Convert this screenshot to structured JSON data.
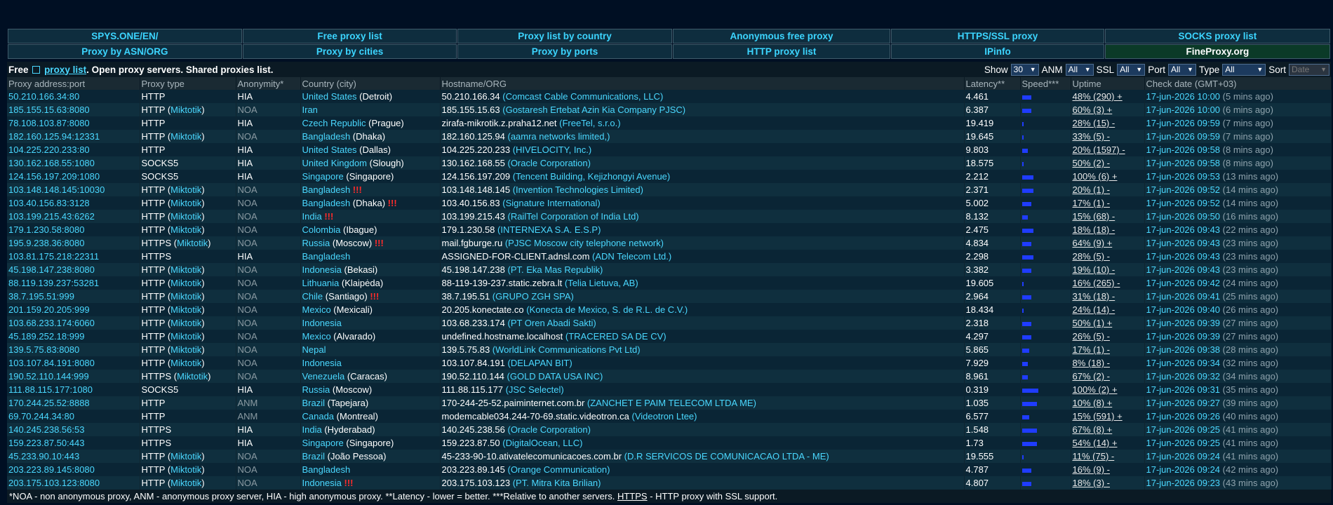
{
  "nav": {
    "row1": [
      "SPYS.ONE/EN/",
      "Free proxy list",
      "Proxy list by country",
      "Anonymous free proxy",
      "HTTPS/SSL proxy",
      "SOCKS proxy list"
    ],
    "row2": [
      "Proxy by ASN/ORG",
      "Proxy by cities",
      "Proxy by ports",
      "HTTP proxy list",
      "IPinfo",
      "FineProxy.org"
    ]
  },
  "header": {
    "free_label": "Free",
    "proxy_list_link": "proxy list",
    "rest": ". Open proxy servers. Shared proxies list."
  },
  "filters": {
    "show_label": "Show",
    "show_value": "30",
    "anm_label": "ANM",
    "anm_value": "All",
    "ssl_label": "SSL",
    "ssl_value": "All",
    "port_label": "Port",
    "port_value": "All",
    "type_label": "Type",
    "type_value": "All",
    "sort_label": "Sort",
    "sort_value": "Date"
  },
  "columns": [
    "Proxy address:port",
    "Proxy type",
    "Anonymity*",
    "Country (city)",
    "Hostname/ORG",
    "Latency**",
    "Speed***",
    "Uptime",
    "Check date (GMT+03)"
  ],
  "colors": {
    "accent": "#4ad8ff",
    "warn": "#ff2b2b",
    "speed": "#1f3cff",
    "bg": "#000f23"
  },
  "rows": [
    {
      "addr": "50.210.166.34:80",
      "type": "HTTP",
      "sub": "",
      "anon": "HIA",
      "country": "United States",
      "city": "Detroit",
      "warn": "",
      "host": "50.210.166.34",
      "org": "Comcast Cable Communications, LLC",
      "lat": "4.461",
      "spd": 0.25,
      "up": "48% (290) +",
      "date": "17-jun-2026 10:00",
      "ago": "(5 mins ago)"
    },
    {
      "addr": "185.155.15.63:8080",
      "type": "HTTP",
      "sub": "Miktotik",
      "anon": "NOA",
      "country": "Iran",
      "city": "",
      "warn": "",
      "host": "185.155.15.63",
      "org": "Gostaresh Ertebat Azin Kia Company PJSC",
      "lat": "6.387",
      "spd": 0.25,
      "up": "60% (3) +",
      "date": "17-jun-2026 10:00",
      "ago": "(6 mins ago)"
    },
    {
      "addr": "78.108.103.87:8080",
      "type": "HTTP",
      "sub": "",
      "anon": "HIA",
      "country": "Czech Republic",
      "city": "Prague",
      "warn": "",
      "host": "zirafa-mikrotik.z.praha12.net",
      "org": "FreeTel, s.r.o.",
      "lat": "19.419",
      "spd": 0.03,
      "up": "28% (15) -",
      "date": "17-jun-2026 09:59",
      "ago": "(7 mins ago)"
    },
    {
      "addr": "182.160.125.94:12331",
      "type": "HTTP",
      "sub": "Miktotik",
      "anon": "NOA",
      "country": "Bangladesh",
      "city": "Dhaka",
      "warn": "",
      "host": "182.160.125.94",
      "org": "aamra networks limited,",
      "lat": "19.645",
      "spd": 0.03,
      "up": "33% (5) -",
      "date": "17-jun-2026 09:59",
      "ago": "(7 mins ago)"
    },
    {
      "addr": "104.225.220.233:80",
      "type": "HTTP",
      "sub": "",
      "anon": "HIA",
      "country": "United States",
      "city": "Dallas",
      "warn": "",
      "host": "104.225.220.233",
      "org": "HIVELOCITY, Inc.",
      "lat": "9.803",
      "spd": 0.15,
      "up": "20% (1597) -",
      "date": "17-jun-2026 09:58",
      "ago": "(8 mins ago)"
    },
    {
      "addr": "130.162.168.55:1080",
      "type": "SOCKS5",
      "sub": "",
      "anon": "HIA",
      "country": "United Kingdom",
      "city": "Slough",
      "warn": "",
      "host": "130.162.168.55",
      "org": "Oracle Corporation",
      "lat": "18.575",
      "spd": 0.03,
      "up": "50% (2) -",
      "date": "17-jun-2026 09:58",
      "ago": "(8 mins ago)"
    },
    {
      "addr": "124.156.197.209:1080",
      "type": "SOCKS5",
      "sub": "",
      "anon": "HIA",
      "country": "Singapore",
      "city": "Singapore",
      "warn": "",
      "host": "124.156.197.209",
      "org": "Tencent Building, Kejizhongyi Avenue",
      "lat": "2.212",
      "spd": 0.3,
      "up": "100% (6) +",
      "date": "17-jun-2026 09:53",
      "ago": "(13 mins ago)"
    },
    {
      "addr": "103.148.148.145:10030",
      "type": "HTTP",
      "sub": "Miktotik",
      "anon": "NOA",
      "country": "Bangladesh",
      "city": "",
      "warn": "!!!",
      "host": "103.148.148.145",
      "org": "Invention Technologies Limited",
      "lat": "2.371",
      "spd": 0.3,
      "up": "20% (1) -",
      "date": "17-jun-2026 09:52",
      "ago": "(14 mins ago)"
    },
    {
      "addr": "103.40.156.83:3128",
      "type": "HTTP",
      "sub": "Miktotik",
      "anon": "NOA",
      "country": "Bangladesh",
      "city": "Dhaka",
      "warn": "!!!",
      "host": "103.40.156.83",
      "org": "Signature International",
      "lat": "5.002",
      "spd": 0.25,
      "up": "17% (1) -",
      "date": "17-jun-2026 09:52",
      "ago": "(14 mins ago)"
    },
    {
      "addr": "103.199.215.43:6262",
      "type": "HTTP",
      "sub": "Miktotik",
      "anon": "NOA",
      "country": "India",
      "city": "",
      "warn": "!!!",
      "host": "103.199.215.43",
      "org": "RailTel Corporation of India Ltd",
      "lat": "8.132",
      "spd": 0.15,
      "up": "15% (68) -",
      "date": "17-jun-2026 09:50",
      "ago": "(16 mins ago)"
    },
    {
      "addr": "179.1.230.58:8080",
      "type": "HTTP",
      "sub": "Miktotik",
      "anon": "NOA",
      "country": "Colombia",
      "city": "Ibague",
      "warn": "",
      "host": "179.1.230.58",
      "org": "INTERNEXA S.A. E.S.P",
      "lat": "2.475",
      "spd": 0.3,
      "up": "18% (18) -",
      "date": "17-jun-2026 09:43",
      "ago": "(22 mins ago)"
    },
    {
      "addr": "195.9.238.36:8080",
      "type": "HTTPS",
      "sub": "Miktotik",
      "anon": "NOA",
      "country": "Russia",
      "city": "Moscow",
      "warn": "!!!",
      "host": "mail.fgburge.ru",
      "org": "PJSC Moscow city telephone network",
      "lat": "4.834",
      "spd": 0.25,
      "up": "64% (9) +",
      "date": "17-jun-2026 09:43",
      "ago": "(23 mins ago)"
    },
    {
      "addr": "103.81.175.218:22311",
      "type": "HTTPS",
      "sub": "",
      "anon": "HIA",
      "country": "Bangladesh",
      "city": "",
      "warn": "",
      "host": "ASSIGNED-FOR-CLIENT.adnsl.com",
      "org": "ADN Telecom Ltd.",
      "lat": "2.298",
      "spd": 0.3,
      "up": "28% (5) -",
      "date": "17-jun-2026 09:43",
      "ago": "(23 mins ago)"
    },
    {
      "addr": "45.198.147.238:8080",
      "type": "HTTP",
      "sub": "Miktotik",
      "anon": "NOA",
      "country": "Indonesia",
      "city": "Bekasi",
      "warn": "",
      "host": "45.198.147.238",
      "org": "PT. Eka Mas Republik",
      "lat": "3.382",
      "spd": 0.25,
      "up": "19% (10) -",
      "date": "17-jun-2026 09:43",
      "ago": "(23 mins ago)"
    },
    {
      "addr": "88.119.139.237:53281",
      "type": "HTTP",
      "sub": "Miktotik",
      "anon": "NOA",
      "country": "Lithuania",
      "city": "Klaipėda",
      "warn": "",
      "host": "88-119-139-237.static.zebra.lt",
      "org": "Telia Lietuva, AB",
      "lat": "19.605",
      "spd": 0.03,
      "up": "16% (265) -",
      "date": "17-jun-2026 09:42",
      "ago": "(24 mins ago)"
    },
    {
      "addr": "38.7.195.51:999",
      "type": "HTTP",
      "sub": "Miktotik",
      "anon": "NOA",
      "country": "Chile",
      "city": "Santiago",
      "warn": "!!!",
      "host": "38.7.195.51",
      "org": "GRUPO ZGH SPA",
      "lat": "2.964",
      "spd": 0.25,
      "up": "31% (18) -",
      "date": "17-jun-2026 09:41",
      "ago": "(25 mins ago)"
    },
    {
      "addr": "201.159.20.205:999",
      "type": "HTTP",
      "sub": "Miktotik",
      "anon": "NOA",
      "country": "Mexico",
      "city": "Mexicali",
      "warn": "",
      "host": "20.205.konectate.co",
      "org": "Konecta de Mexico, S. de R.L. de C.V.",
      "lat": "18.434",
      "spd": 0.03,
      "up": "24% (14) -",
      "date": "17-jun-2026 09:40",
      "ago": "(26 mins ago)"
    },
    {
      "addr": "103.68.233.174:6060",
      "type": "HTTP",
      "sub": "Miktotik",
      "anon": "NOA",
      "country": "Indonesia",
      "city": "",
      "warn": "",
      "host": "103.68.233.174",
      "org": "PT Oren Abadi Sakti",
      "lat": "2.318",
      "spd": 0.25,
      "up": "50% (1) +",
      "date": "17-jun-2026 09:39",
      "ago": "(27 mins ago)"
    },
    {
      "addr": "45.189.252.18:999",
      "type": "HTTP",
      "sub": "Miktotik",
      "anon": "NOA",
      "country": "Mexico",
      "city": "Alvarado",
      "warn": "",
      "host": "undefined.hostname.localhost",
      "org": "TRACERED SA DE CV",
      "lat": "4.297",
      "spd": 0.25,
      "up": "26% (5) -",
      "date": "17-jun-2026 09:39",
      "ago": "(27 mins ago)"
    },
    {
      "addr": "139.5.75.83:8080",
      "type": "HTTP",
      "sub": "Miktotik",
      "anon": "NOA",
      "country": "Nepal",
      "city": "",
      "warn": "",
      "host": "139.5.75.83",
      "org": "WorldLink Communications Pvt Ltd",
      "lat": "5.865",
      "spd": 0.2,
      "up": "17% (1) -",
      "date": "17-jun-2026 09:38",
      "ago": "(28 mins ago)"
    },
    {
      "addr": "103.107.84.191:8080",
      "type": "HTTP",
      "sub": "Miktotik",
      "anon": "NOA",
      "country": "Indonesia",
      "city": "",
      "warn": "",
      "host": "103.107.84.191",
      "org": "DELAPAN BIT",
      "lat": "7.929",
      "spd": 0.15,
      "up": "8% (18) -",
      "date": "17-jun-2026 09:34",
      "ago": "(32 mins ago)"
    },
    {
      "addr": "190.52.110.144:999",
      "type": "HTTPS",
      "sub": "Miktotik",
      "anon": "NOA",
      "country": "Venezuela",
      "city": "Caracas",
      "warn": "",
      "host": "190.52.110.144",
      "org": "GOLD DATA USA INC",
      "lat": "8.961",
      "spd": 0.15,
      "up": "67% (2) -",
      "date": "17-jun-2026 09:32",
      "ago": "(34 mins ago)"
    },
    {
      "addr": "111.88.115.177:1080",
      "type": "SOCKS5",
      "sub": "",
      "anon": "HIA",
      "country": "Russia",
      "city": "Moscow",
      "warn": "",
      "host": "111.88.115.177",
      "org": "JSC Selectel",
      "lat": "0.319",
      "spd": 0.45,
      "up": "100% (2) +",
      "date": "17-jun-2026 09:31",
      "ago": "(35 mins ago)"
    },
    {
      "addr": "170.244.25.52:8888",
      "type": "HTTP",
      "sub": "",
      "anon": "ANM",
      "country": "Brazil",
      "city": "Tapejara",
      "warn": "",
      "host": "170-244-25-52.paiminternet.com.br",
      "org": "ZANCHET E PAIM TELECOM LTDA ME",
      "lat": "1.035",
      "spd": 0.4,
      "up": "10% (8) +",
      "date": "17-jun-2026 09:27",
      "ago": "(39 mins ago)"
    },
    {
      "addr": "69.70.244.34:80",
      "type": "HTTP",
      "sub": "",
      "anon": "ANM",
      "country": "Canada",
      "city": "Montreal",
      "warn": "",
      "host": "modemcable034.244-70-69.static.videotron.ca",
      "org": "Videotron Ltee",
      "lat": "6.577",
      "spd": 0.2,
      "up": "15% (591) +",
      "date": "17-jun-2026 09:26",
      "ago": "(40 mins ago)"
    },
    {
      "addr": "140.245.238.56:53",
      "type": "HTTPS",
      "sub": "",
      "anon": "HIA",
      "country": "India",
      "city": "Hyderabad",
      "warn": "",
      "host": "140.245.238.56",
      "org": "Oracle Corporation",
      "lat": "1.548",
      "spd": 0.4,
      "up": "67% (8) +",
      "date": "17-jun-2026 09:25",
      "ago": "(41 mins ago)"
    },
    {
      "addr": "159.223.87.50:443",
      "type": "HTTPS",
      "sub": "",
      "anon": "HIA",
      "country": "Singapore",
      "city": "Singapore",
      "warn": "",
      "host": "159.223.87.50",
      "org": "DigitalOcean, LLC",
      "lat": "1.73",
      "spd": 0.4,
      "up": "54% (14) +",
      "date": "17-jun-2026 09:25",
      "ago": "(41 mins ago)"
    },
    {
      "addr": "45.233.90.10:443",
      "type": "HTTP",
      "sub": "Miktotik",
      "anon": "NOA",
      "country": "Brazil",
      "city": "João Pessoa",
      "warn": "",
      "host": "45-233-90-10.ativatelecomunicacoes.com.br",
      "org": "D.R SERVICOS DE COMUNICACAO LTDA - ME",
      "lat": "19.555",
      "spd": 0.03,
      "up": "11% (75) -",
      "date": "17-jun-2026 09:24",
      "ago": "(41 mins ago)"
    },
    {
      "addr": "203.223.89.145:8080",
      "type": "HTTP",
      "sub": "Miktotik",
      "anon": "NOA",
      "country": "Bangladesh",
      "city": "",
      "warn": "",
      "host": "203.223.89.145",
      "org": "Orange Communication",
      "lat": "4.787",
      "spd": 0.25,
      "up": "16% (9) -",
      "date": "17-jun-2026 09:24",
      "ago": "(42 mins ago)"
    },
    {
      "addr": "203.175.103.123:8080",
      "type": "HTTP",
      "sub": "Miktotik",
      "anon": "NOA",
      "country": "Indonesia",
      "city": "",
      "warn": "!!!",
      "host": "203.175.103.123",
      "org": "PT. Mitra Kita Brilian",
      "lat": "4.807",
      "spd": 0.25,
      "up": "18% (3) -",
      "date": "17-jun-2026 09:23",
      "ago": "(43 mins ago)"
    }
  ],
  "footer": {
    "text1": "*NOA - non anonymous proxy, ANM - anonymous proxy server, HIA - high anonymous proxy. **Latency - lower = better. ***Relative to another servers. ",
    "https_word": "HTTPS",
    "text2": " - HTTP proxy with SSL support."
  }
}
